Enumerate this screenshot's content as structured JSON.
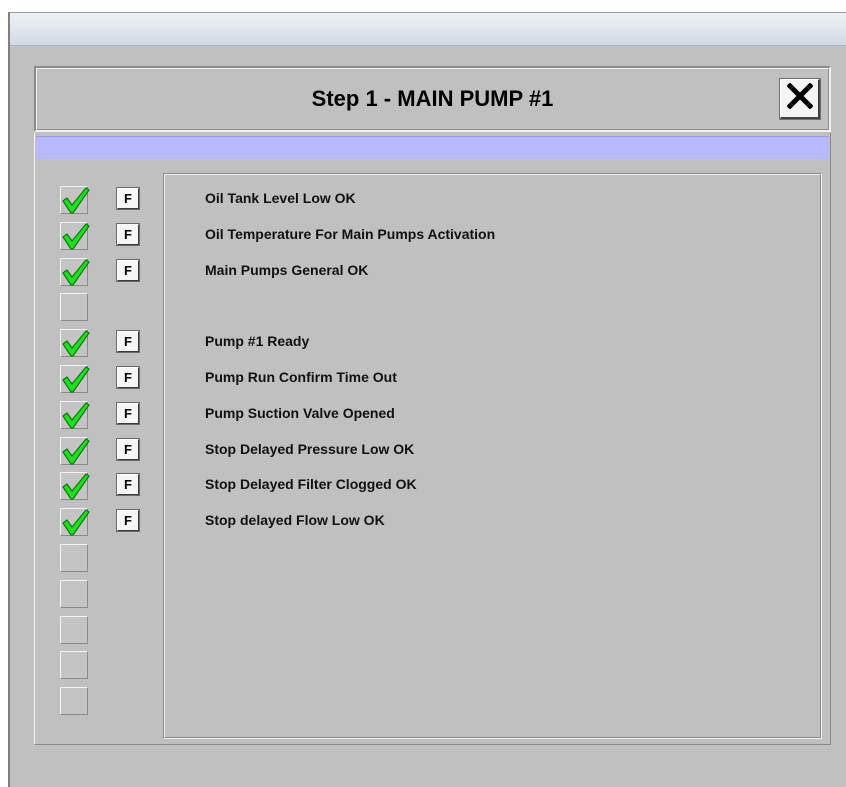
{
  "header": {
    "title": "Step 1 - MAIN PUMP #1",
    "close_icon": "close-x-icon"
  },
  "colors": {
    "panel_bg": "#c0c0c0",
    "status_bar": "#b8b8ff",
    "check_green": "#22dd22"
  },
  "conditions": [
    {
      "checked": true,
      "has_button": true,
      "button_label": "F",
      "label": "Oil Tank Level Low OK"
    },
    {
      "checked": true,
      "has_button": true,
      "button_label": "F",
      "label": "Oil Temperature For Main Pumps Activation"
    },
    {
      "checked": true,
      "has_button": true,
      "button_label": "F",
      "label": "Main Pumps General OK"
    },
    {
      "checked": false,
      "has_button": false,
      "button_label": "",
      "label": ""
    },
    {
      "checked": true,
      "has_button": true,
      "button_label": "F",
      "label": "Pump #1 Ready"
    },
    {
      "checked": true,
      "has_button": true,
      "button_label": "F",
      "label": "Pump Run Confirm Time Out"
    },
    {
      "checked": true,
      "has_button": true,
      "button_label": "F",
      "label": "Pump Suction Valve Opened"
    },
    {
      "checked": true,
      "has_button": true,
      "button_label": "F",
      "label": "Stop Delayed Pressure Low OK"
    },
    {
      "checked": true,
      "has_button": true,
      "button_label": "F",
      "label": "Stop Delayed Filter Clogged OK"
    },
    {
      "checked": true,
      "has_button": true,
      "button_label": "F",
      "label": "Stop delayed Flow Low OK"
    },
    {
      "checked": false,
      "has_button": false,
      "button_label": "",
      "label": ""
    },
    {
      "checked": false,
      "has_button": false,
      "button_label": "",
      "label": ""
    },
    {
      "checked": false,
      "has_button": false,
      "button_label": "",
      "label": ""
    },
    {
      "checked": false,
      "has_button": false,
      "button_label": "",
      "label": ""
    },
    {
      "checked": false,
      "has_button": false,
      "button_label": "",
      "label": ""
    }
  ]
}
